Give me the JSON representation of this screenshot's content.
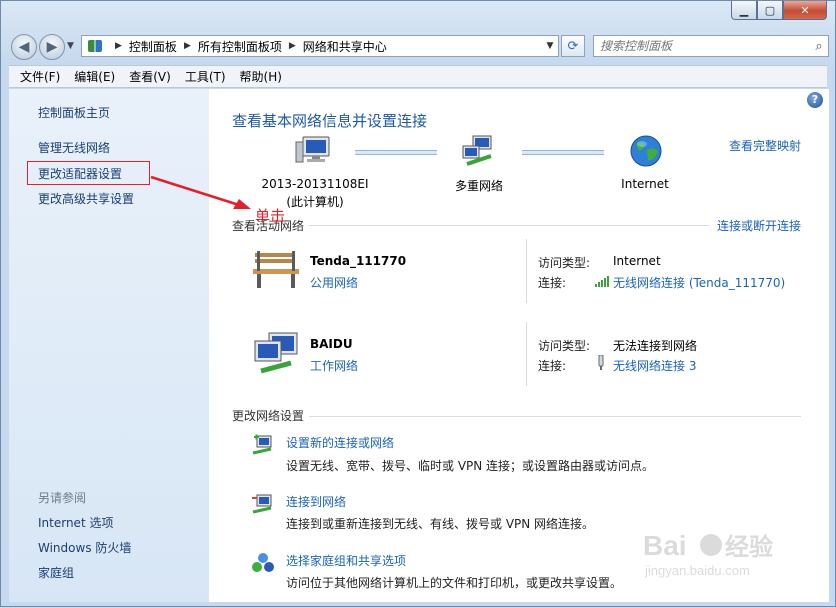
{
  "address": {
    "crumbs": [
      "控制面板",
      "所有控制面板项",
      "网络和共享中心"
    ]
  },
  "search": {
    "placeholder": "搜索控制面板"
  },
  "menu": [
    "文件(F)",
    "编辑(E)",
    "查看(V)",
    "工具(T)",
    "帮助(H)"
  ],
  "sidebar": {
    "links": [
      "控制面板主页",
      "管理无线网络",
      "更改适配器设置",
      "更改高级共享设置"
    ],
    "see_also_title": "另请参阅",
    "see_also": [
      "Internet 选项",
      "Windows 防火墙",
      "家庭组"
    ]
  },
  "main": {
    "title": "查看基本网络信息并设置连接",
    "full_map": "查看完整映射",
    "map": {
      "computer_name": "2013-20131108EI",
      "computer_sub": "(此计算机)",
      "multi_network": "多重网络",
      "internet": "Internet"
    },
    "active_title": "查看活动网络",
    "connect_disconnect": "连接或断开连接",
    "networks": [
      {
        "name": "Tenda_111770",
        "type": "公用网络",
        "access_label": "访问类型:",
        "access_value": "Internet",
        "conn_label": "连接:",
        "conn_value": "无线网络连接 (Tenda_111770)"
      },
      {
        "name": "BAIDU",
        "type": "工作网络",
        "access_label": "访问类型:",
        "access_value": "无法连接到网络",
        "conn_label": "连接:",
        "conn_value": "无线网络连接 3"
      }
    ],
    "change_title": "更改网络设置",
    "tasks": [
      {
        "link": "设置新的连接或网络",
        "desc": "设置无线、宽带、拨号、临时或 VPN 连接；或设置路由器或访问点。"
      },
      {
        "link": "连接到网络",
        "desc": "连接到或重新连接到无线、有线、拨号或 VPN 网络连接。"
      },
      {
        "link": "选择家庭组和共享选项",
        "desc": "访问位于其他网络计算机上的文件和打印机，或更改共享设置。"
      }
    ]
  },
  "annotation": {
    "text": "单击",
    "color": "#e0232a"
  },
  "colors": {
    "link": "#1c63b8",
    "title": "#1e5aa6",
    "sidebar": "#e9f1fa"
  },
  "watermark": {
    "text": "Baidu 经验",
    "sub": "jingyan.baidu.com"
  }
}
